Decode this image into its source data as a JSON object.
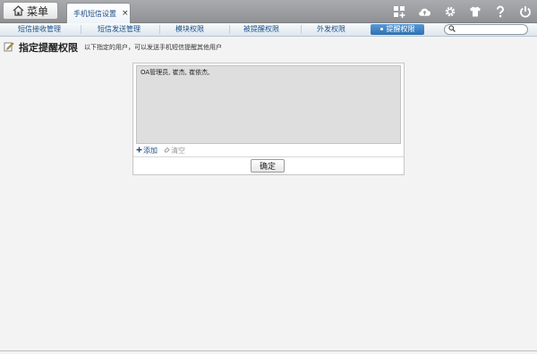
{
  "topbar": {
    "menu_label": "菜单",
    "tab_label": "手机短信设置",
    "tab_close": "×",
    "icons": [
      "grid-plus-icon",
      "cloud-upload-icon",
      "gear-icon",
      "shirt-icon",
      "help-icon",
      "power-icon"
    ]
  },
  "nav": {
    "items": [
      {
        "label": "短信接收管理",
        "active": false
      },
      {
        "label": "短信发送管理",
        "active": false
      },
      {
        "label": "模块权限",
        "active": false
      },
      {
        "label": "被提醒权限",
        "active": false
      },
      {
        "label": "外发权限",
        "active": false
      },
      {
        "label": "提醒权限",
        "active": true
      }
    ],
    "search_placeholder": ""
  },
  "page": {
    "title": "指定提醒权限",
    "description": "以下指定的用户，可以发送手机短信提醒其他用户"
  },
  "panel": {
    "users_text": "OA管理员, 崔杰, 崔依杰,",
    "add_label": "添加",
    "clear_label": "清空",
    "confirm_label": "确定"
  },
  "colors": {
    "accent": "#2d6fb0",
    "link": "#1d4f86",
    "textarea_bg": "#dedede"
  }
}
